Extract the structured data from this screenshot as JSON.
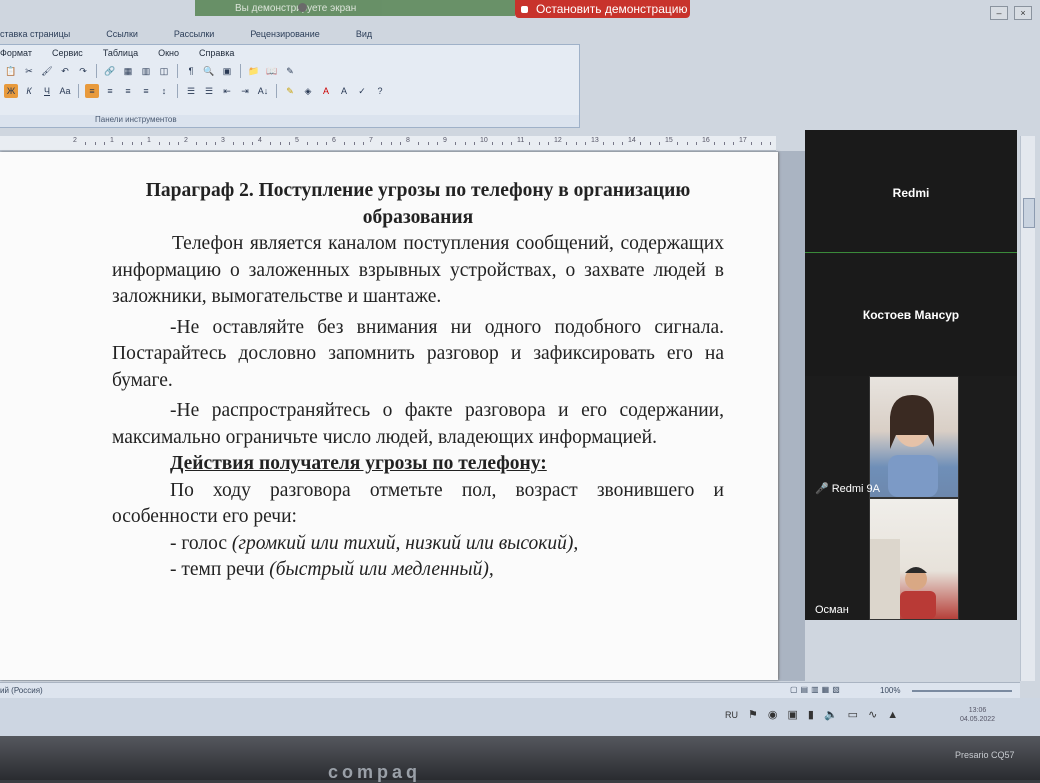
{
  "zoom_bar": {
    "sharing_text": "Вы демонстрируете экран",
    "stop_button": "Остановить демонстрацию"
  },
  "ribbon_tabs": [
    "Вставка страницы",
    "Ссылки",
    "Рассылки",
    "Рецензирование",
    "Вид"
  ],
  "menu": [
    "Формат",
    "Сервис",
    "Таблица",
    "Окно",
    "Справка"
  ],
  "toolbar_panel_label": "Панели инструментов",
  "ruler_numbers": [
    "2",
    "1",
    "1",
    "2",
    "3",
    "4",
    "5",
    "6",
    "7",
    "8",
    "9",
    "10",
    "11",
    "12",
    "13",
    "14",
    "15",
    "16",
    "17"
  ],
  "document": {
    "title": "Параграф 2. Поступление угрозы по телефону в организацию образования",
    "p1": "Телефон является каналом поступления сообщений, содержащих информацию о заложенных взрывных устройствах, о захвате людей в заложники, вымогательстве и шантаже.",
    "p2": "-Не оставляйте без внимания ни одного подобного сигнала. Постарайтесь дословно запомнить разговор и зафиксировать его на бумаге.",
    "p3": "-Не распространяйтесь о факте разговора и его содержании, максимально ограничьте число людей, владеющих информацией.",
    "heading": "Действия получателя угрозы по телефону:",
    "p4": "По ходу разговора отметьте пол, возраст звонившего и особенности его речи:",
    "item1_prefix": "- голос",
    "item1_italic": "(громкий или тихий, низкий или высокий),",
    "item2_prefix": "- темп речи",
    "item2_italic": "(быстрый или медленный),"
  },
  "participants": [
    {
      "name": "Redmi"
    },
    {
      "name": "Костоев Мансур"
    },
    {
      "name": "Redmi 9A"
    },
    {
      "name": "Осман"
    }
  ],
  "status_bar": {
    "language": "ий (Россия)",
    "zoom": "100%"
  },
  "taskbar": {
    "lang": "RU",
    "time": "13:06",
    "date": "04.05.2022"
  },
  "bezel": {
    "brand": "compaq",
    "model": "Presario CQ57"
  }
}
